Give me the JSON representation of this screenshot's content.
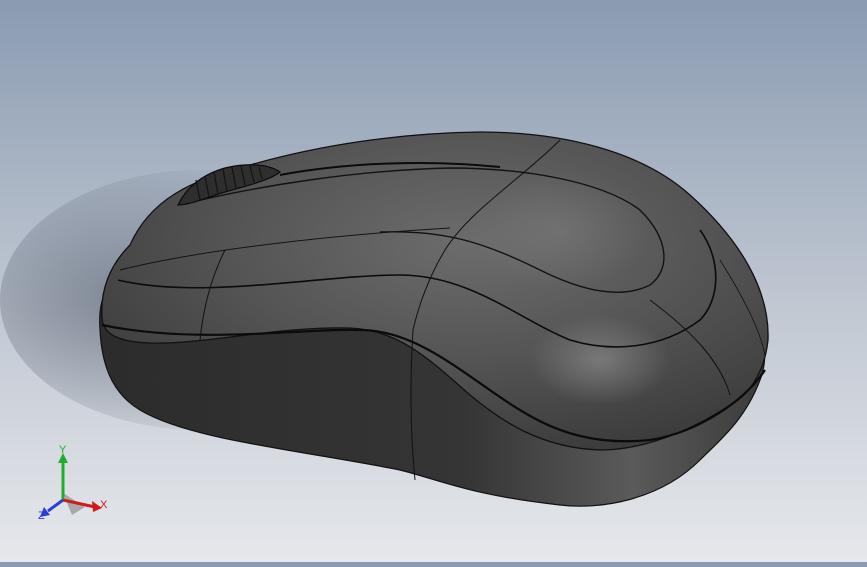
{
  "triad": {
    "x_label": "X",
    "y_label": "Y",
    "z_label": "Z",
    "colors": {
      "x": "#d11b1b",
      "y": "#1fae2b",
      "z": "#2b3fd6"
    }
  },
  "model": {
    "body_color": "#4a4a4a",
    "edge_color": "#0d0d0d"
  }
}
